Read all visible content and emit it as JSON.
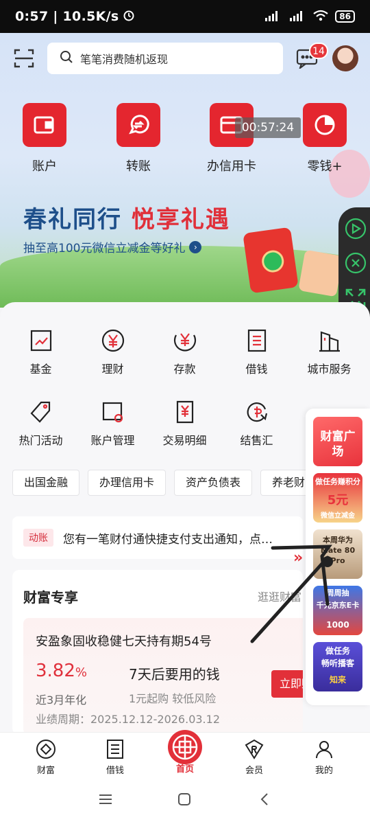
{
  "status_bar": {
    "time": "0:57 | 10.5K/s",
    "battery": "86"
  },
  "search": {
    "placeholder": "笔笔消费随机返现"
  },
  "messages": {
    "badge": "14"
  },
  "quick_actions": [
    {
      "label": "账户",
      "icon": "wallet-icon"
    },
    {
      "label": "转账",
      "icon": "transfer-icon"
    },
    {
      "label": "办信用卡",
      "icon": "credit-card-icon"
    },
    {
      "label": "零钱+",
      "icon": "pie-chart-icon"
    }
  ],
  "recording_timer": "00:57:24",
  "banner": {
    "title_a": "春礼同行",
    "title_b": "悦享礼遇",
    "subtitle": "抽至高100元微信立减金等好礼"
  },
  "services_row1": [
    {
      "label": "基金",
      "icon": "fund-chart-icon"
    },
    {
      "label": "理财",
      "icon": "yuan-circle-icon"
    },
    {
      "label": "存款",
      "icon": "deposit-icon"
    },
    {
      "label": "借钱",
      "icon": "borrow-doc-icon"
    },
    {
      "label": "城市服务",
      "icon": "city-building-icon"
    }
  ],
  "services_row2": [
    {
      "label": "热门活动",
      "icon": "tag-icon"
    },
    {
      "label": "账户管理",
      "icon": "account-manage-icon"
    },
    {
      "label": "交易明细",
      "icon": "transaction-doc-icon"
    },
    {
      "label": "结售汇",
      "icon": "exchange-icon"
    }
  ],
  "chips": [
    "出国金融",
    "办理信用卡",
    "资产负债表",
    "养老财"
  ],
  "notice": {
    "tag": "动账",
    "text": "您有一笔财付通快捷支付支出通知，点…"
  },
  "wealth": {
    "title": "财富专享",
    "more": "逛逛财富",
    "product": {
      "name": "安盈象固收稳健七天持有期54号",
      "rate": "3.82",
      "rate_unit": "%",
      "rate_label": "近3月年化",
      "slogan": "7天后要用的钱",
      "slogan_sub": "1元起购 较低风险",
      "period": "业绩周期：2025.12.12-2026.03.12",
      "buy_label": "立即购"
    }
  },
  "promos": {
    "p1": "财富广场",
    "p2_top": "做任务赚积分",
    "p2_mid": "5元",
    "p2_bot": "微信立减金",
    "p3": "本周华为 Mate 80 Pro",
    "p4_top": "周周抽",
    "p4_mid": "千元京东E卡",
    "p4_bot": "1000",
    "p5_top": "做任务",
    "p5_mid": "畅听播客",
    "p5_bot": "知来"
  },
  "bottom_nav": [
    {
      "label": "财富"
    },
    {
      "label": "借钱"
    },
    {
      "label": "首页"
    },
    {
      "label": "会员"
    },
    {
      "label": "我的"
    }
  ],
  "colors": {
    "brand_red": "#e23039",
    "banner_blue": "#1e4f8a"
  }
}
